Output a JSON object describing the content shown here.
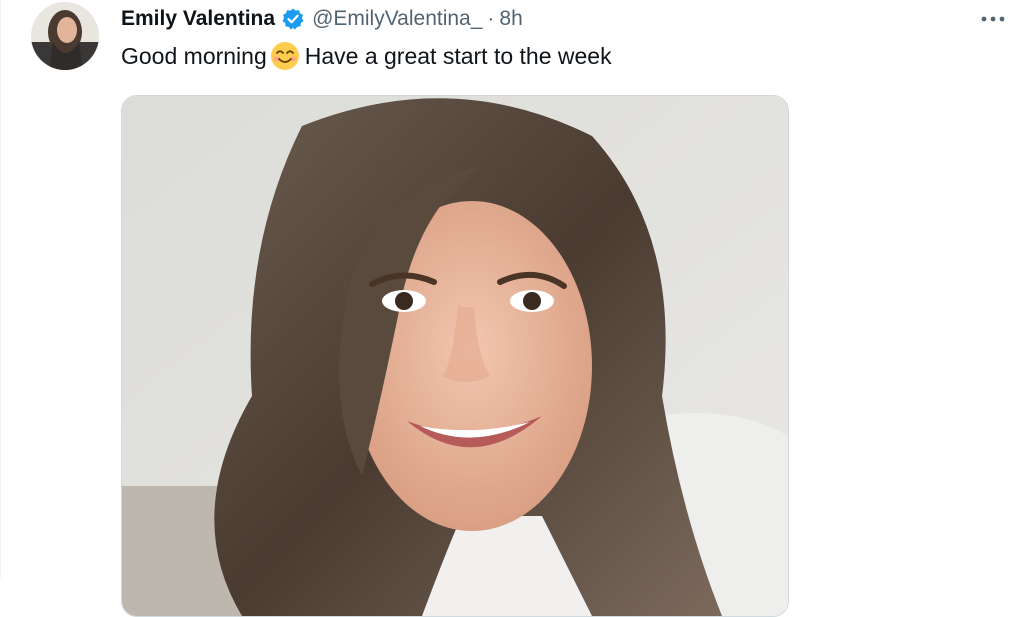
{
  "tweet": {
    "author_name": "Emily Valentina",
    "handle": "@EmilyValentina_",
    "separator": "·",
    "time": "8h",
    "text_before_emoji": "Good morning",
    "text_after_emoji": "Have a great start to the week",
    "more_menu_label": "···"
  },
  "icons": {
    "verified": "verified-badge-icon",
    "emoji": "smiling-face-with-smiling-eyes-icon",
    "more": "more-options-icon"
  },
  "colors": {
    "verified_blue": "#1d9bf0",
    "secondary_text": "#536471",
    "primary_text": "#0f1419"
  }
}
